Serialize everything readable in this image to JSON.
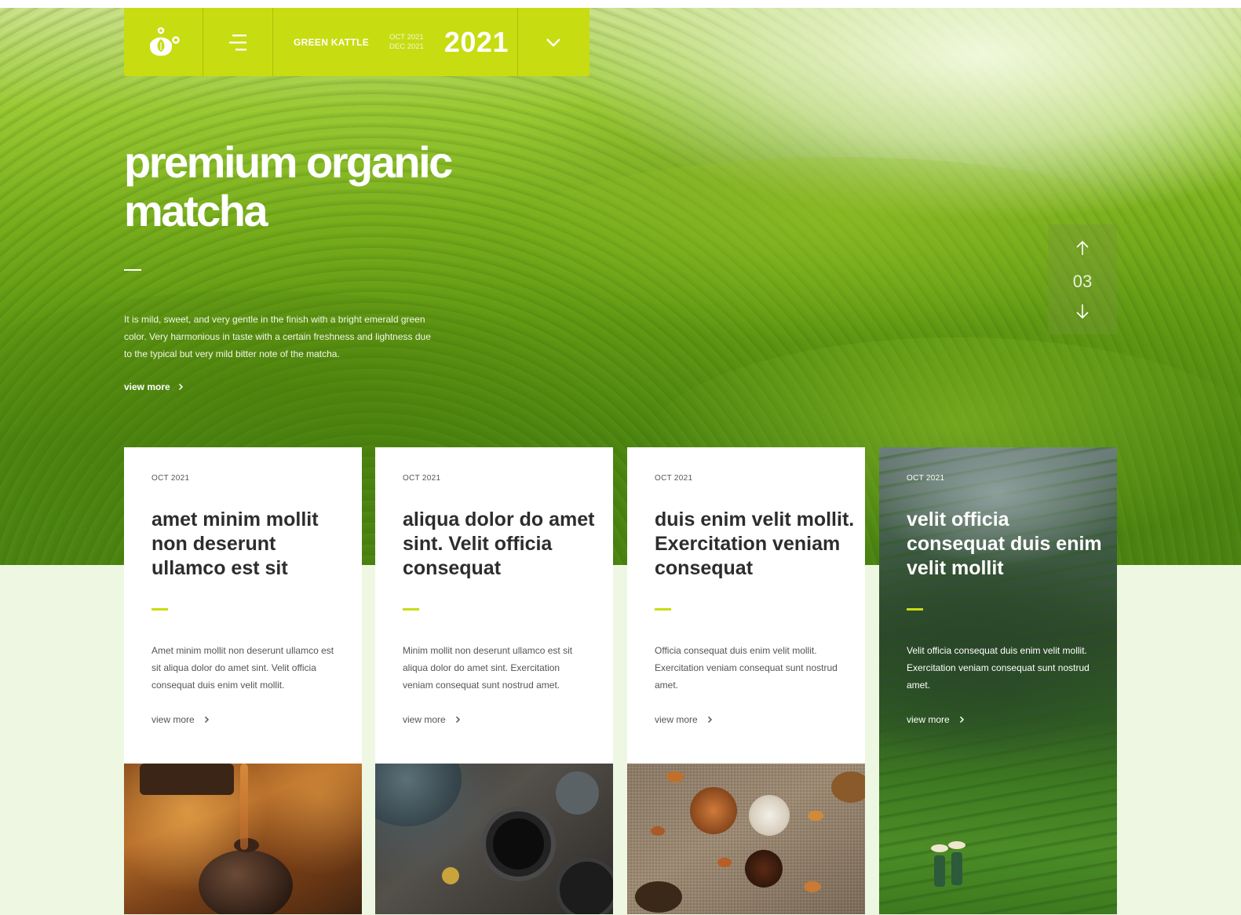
{
  "colors": {
    "accent": "#c8dc12",
    "light_background": "#eef7e2",
    "heading": "#2d2d2d",
    "body_text": "#555555"
  },
  "topbar": {
    "logo_icon": "teapot-leaf-icon",
    "menu_icon": "menu-lines-icon",
    "brand": "GREEN KATTLE",
    "date_from": "OCT 2021",
    "date_to": "DEC 2021",
    "year": "2021",
    "dropdown_icon": "chevron-down-icon"
  },
  "hero": {
    "title_line1": "premium organic",
    "title_line2": "matcha",
    "description": "It is mild, sweet, and very gentle in the finish with a bright emerald green color. Very harmonious in taste with a certain freshness and lightness due to the typical but very mild bitter note of the matcha.",
    "view_more": "view more"
  },
  "pager": {
    "up_icon": "arrow-up-icon",
    "current": "03",
    "down_icon": "arrow-down-icon"
  },
  "cards": [
    {
      "date": "OCT 2021",
      "title": "amet minim mollit non deserunt ullamco est sit",
      "text": "Amet minim mollit non deserunt ullamco est sit aliqua dolor do amet sint. Velit officia consequat duis enim velit mollit.",
      "view_more": "view more",
      "image": "tea-pouring-photo"
    },
    {
      "date": "OCT 2021",
      "title": "aliqua dolor do amet sint. Velit officia consequat",
      "text": "Minim mollit non deserunt ullamco est sit aliqua dolor do amet sint. Exercitation veniam consequat sunt nostrud amet.",
      "view_more": "view more",
      "image": "tea-cups-photo"
    },
    {
      "date": "OCT 2021",
      "title": "duis enim velit mollit. Exercitation veniam consequat",
      "text": "Officia consequat duis enim velit mollit. Exercitation veniam consequat sunt nostrud amet.",
      "view_more": "view more",
      "image": "tea-leaves-cloth-photo"
    },
    {
      "date": "OCT 2021",
      "title": "velit officia consequat duis enim velit mollit",
      "text": "Velit officia consequat duis enim velit mollit. Exercitation veniam consequat sunt nostrud amet.",
      "view_more": "view more",
      "image": "tea-plantation-photo"
    }
  ]
}
